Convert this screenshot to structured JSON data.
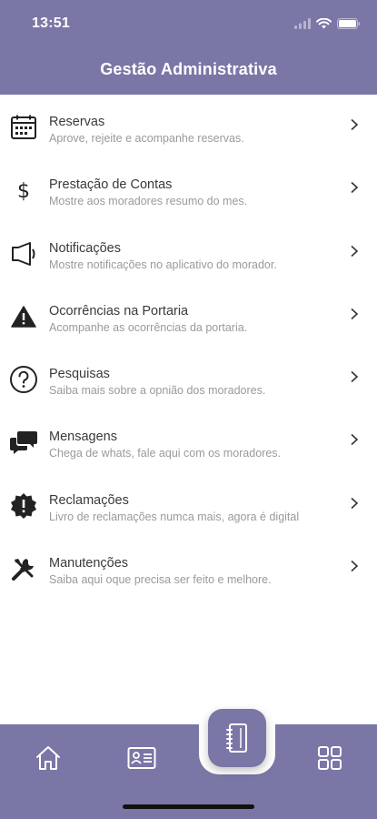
{
  "status_bar": {
    "time": "13:51"
  },
  "header": {
    "title": "Gestão Administrativa"
  },
  "menu": {
    "items": [
      {
        "title": "Reservas",
        "description": "Aprove, rejeite e acompanhe reservas."
      },
      {
        "title": "Prestação de Contas",
        "description": "Mostre aos moradores resumo do mes."
      },
      {
        "title": "Notificações",
        "description": "Mostre notificações no aplicativo do morador."
      },
      {
        "title": "Ocorrências na Portaria",
        "description": "Acompanhe as ocorrências da portaria."
      },
      {
        "title": "Pesquisas",
        "description": "Saiba mais sobre a opnião dos moradores."
      },
      {
        "title": "Mensagens",
        "description": "Chega de whats, fale aqui com os moradores."
      },
      {
        "title": "Reclamações",
        "description": "Livro de reclamações numca mais, agora é digital"
      },
      {
        "title": "Manutenções",
        "description": "Saiba aqui oque precisa ser feito e melhore."
      }
    ]
  },
  "icons": {
    "menu": [
      "calendar-icon",
      "dollar-icon",
      "megaphone-icon",
      "warning-icon",
      "question-icon",
      "chat-bubbles-icon",
      "alert-badge-icon",
      "wrench-icon"
    ],
    "tabbar": [
      "home-icon",
      "id-card-icon",
      "notebook-icon",
      "grid-icon"
    ]
  },
  "colors": {
    "primary": "#7a76a6",
    "title_text": "#3a3a3a",
    "desc_text": "#9a9a9a"
  }
}
